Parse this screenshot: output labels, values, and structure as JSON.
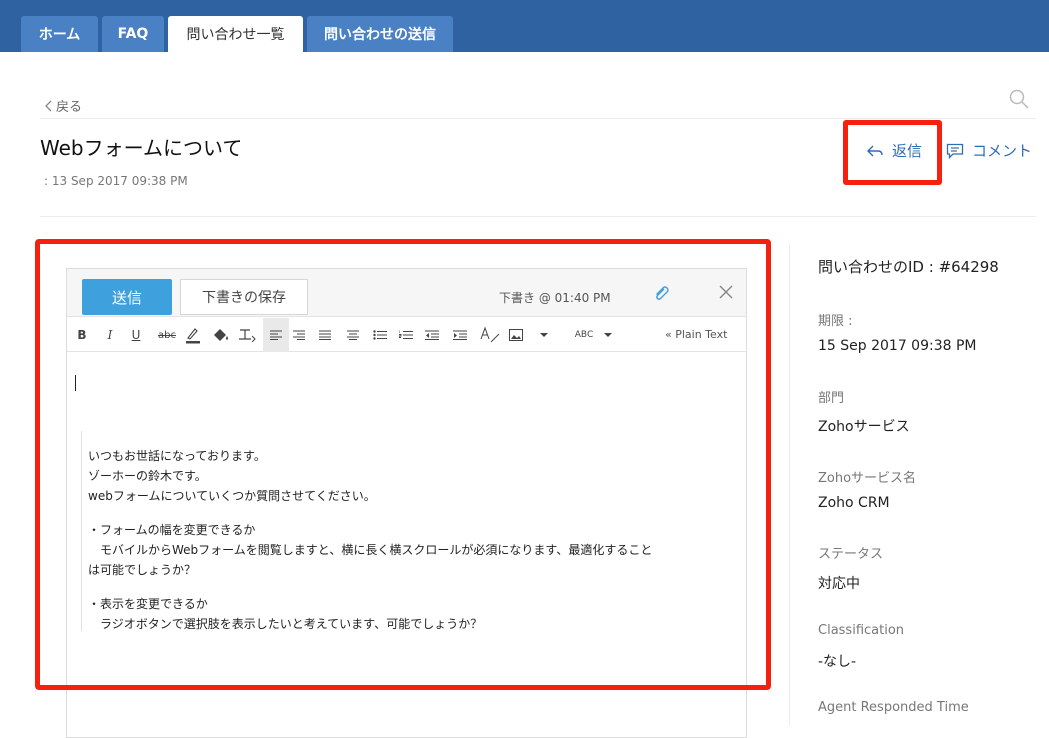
{
  "nav": {
    "tabs": [
      {
        "label": "ホーム"
      },
      {
        "label": "FAQ"
      },
      {
        "label": "問い合わせ一覧"
      },
      {
        "label": "問い合わせの送信"
      }
    ]
  },
  "header": {
    "back_label": "戻る",
    "title": "Webフォームについて",
    "date": "13 Sep 2017 09:38 PM",
    "reply_label": "返信",
    "comment_label": "コメント"
  },
  "editor": {
    "send_label": "送信",
    "save_draft_label": "下書きの保存",
    "draft_time": "下書き @ 01:40 PM",
    "plain_text_label": "« Plain Text",
    "toolbar": {
      "bold": "B",
      "italic": "I",
      "underline": "U",
      "strike": "abc",
      "spell": "ABC"
    },
    "quoted_lines": [
      "いつもお世話になっております。",
      "ゾーホーの鈴木です。",
      "webフォームについていくつか質問させてください。",
      "",
      "・フォームの幅を変更できるか",
      "　モバイルからWebフォームを閲覧しますと、横に長く横スクロールが必須になります、最適化すること",
      "は可能でしょうか？",
      "",
      "・表示を変更できるか",
      "　ラジオボタンで選択肢を表示したいと考えています、可能でしょうか？"
    ]
  },
  "side_panel": {
    "ticket_id": "問い合わせのID : #64298",
    "fields": [
      {
        "label": "期限 :",
        "value": "15 Sep 2017 09:38 PM"
      },
      {
        "label": "部門",
        "value": "Zohoサービス"
      },
      {
        "label": "Zohoサービス名",
        "value": "Zoho CRM"
      },
      {
        "label": "ステータス",
        "value": "対応中"
      },
      {
        "label": "Classification",
        "value": "-なし-"
      },
      {
        "label": "Agent Responded Time",
        "value": ""
      }
    ]
  },
  "colors": {
    "nav_bg": "#2f62a1",
    "tab_bg": "#4a80c4",
    "accent": "#2f6db5",
    "send_button": "#3ea0dc",
    "highlight": "#f5200e"
  },
  "icons": [
    "chevron-left-icon",
    "search-icon",
    "reply-icon",
    "comment-icon",
    "paperclip-icon",
    "close-icon"
  ]
}
